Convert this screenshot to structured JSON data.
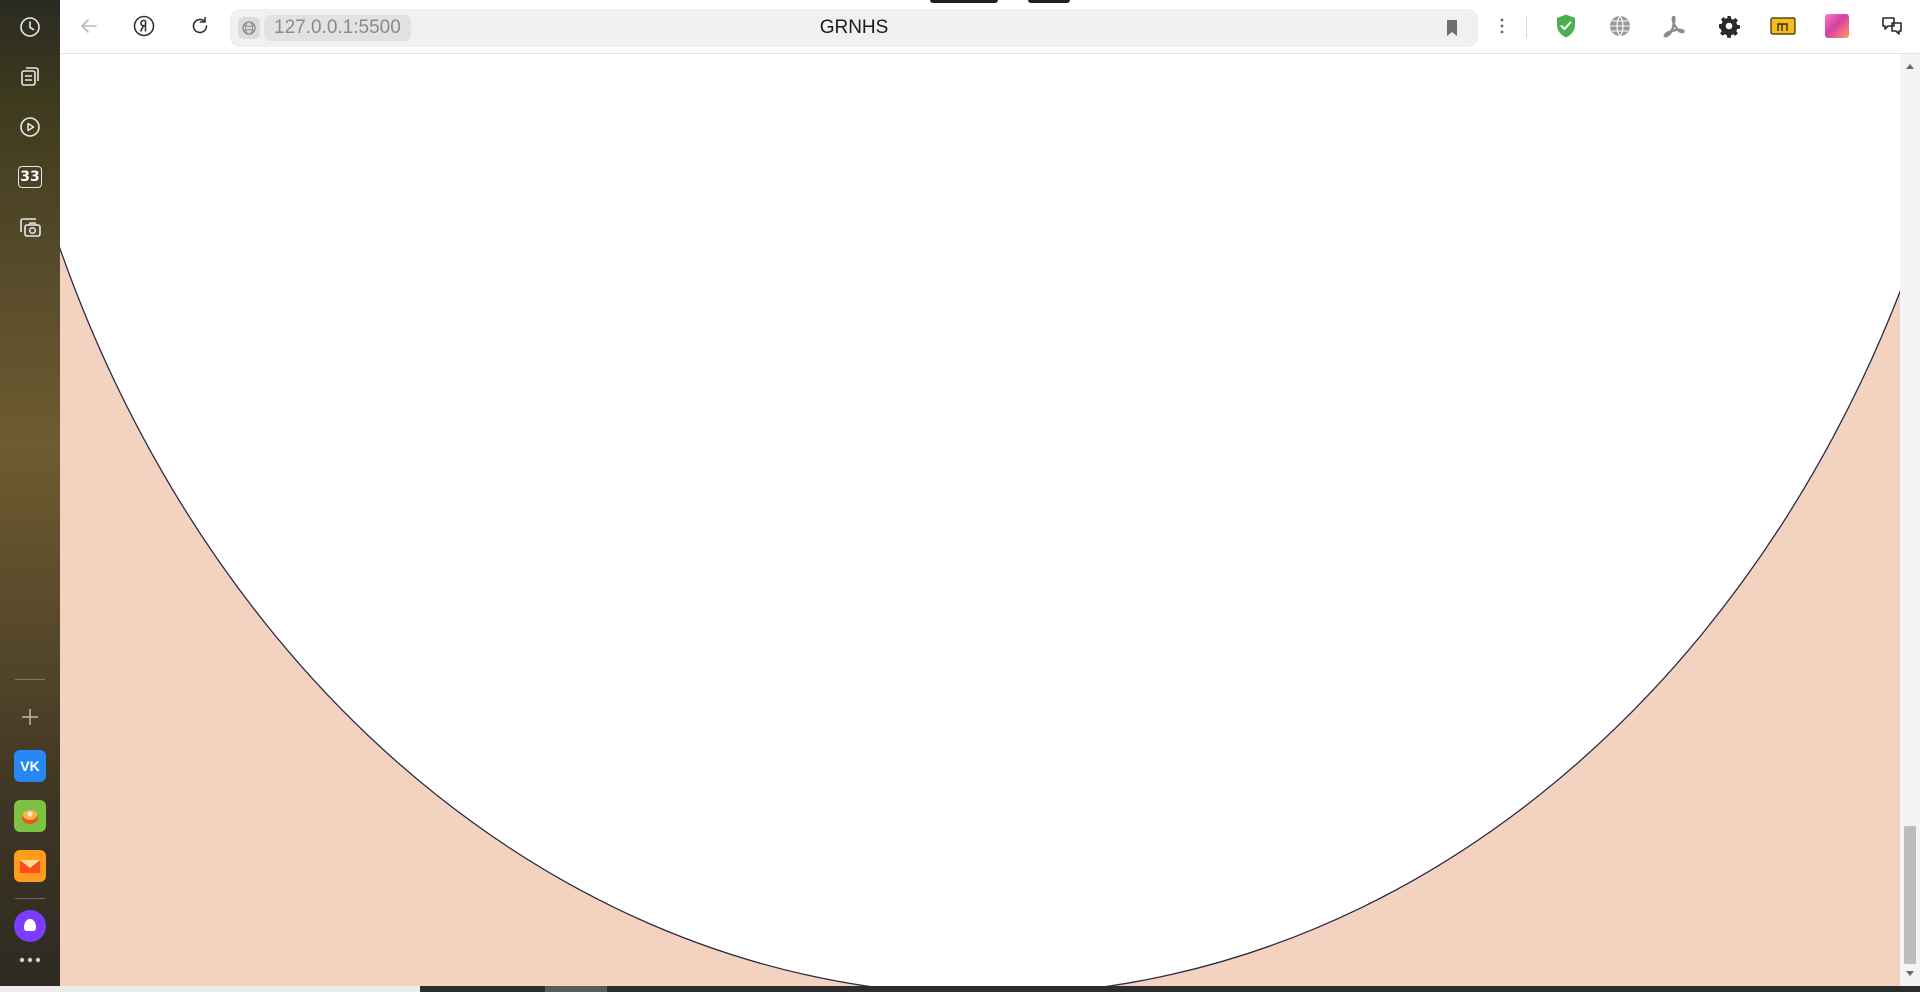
{
  "browser": {
    "url": "127.0.0.1:5500",
    "tab_title": "GRNHS"
  },
  "sidebar": {
    "items": [
      {
        "name": "history",
        "icon": "clock-icon"
      },
      {
        "name": "collections",
        "icon": "collections-icon"
      },
      {
        "name": "video",
        "icon": "play-icon"
      },
      {
        "name": "calendar",
        "icon": "calendar-icon",
        "label": "33"
      },
      {
        "name": "screenshot",
        "icon": "camera-icon"
      }
    ],
    "apps": [
      {
        "name": "vk",
        "icon": "vk-icon",
        "label": "VK",
        "color": "#2787f5"
      },
      {
        "name": "game",
        "icon": "game-icon",
        "color": "#7cc243"
      },
      {
        "name": "mail",
        "icon": "mail-icon",
        "color": "#ff9d1a"
      },
      {
        "name": "alice",
        "icon": "alice-icon",
        "color": "#7b3cff"
      }
    ]
  },
  "colors": {
    "page_fill": "#f3d3c0",
    "circle_fill": "#ffffff",
    "circle_stroke": "#2b2b44",
    "shield_green": "#4caf50"
  }
}
